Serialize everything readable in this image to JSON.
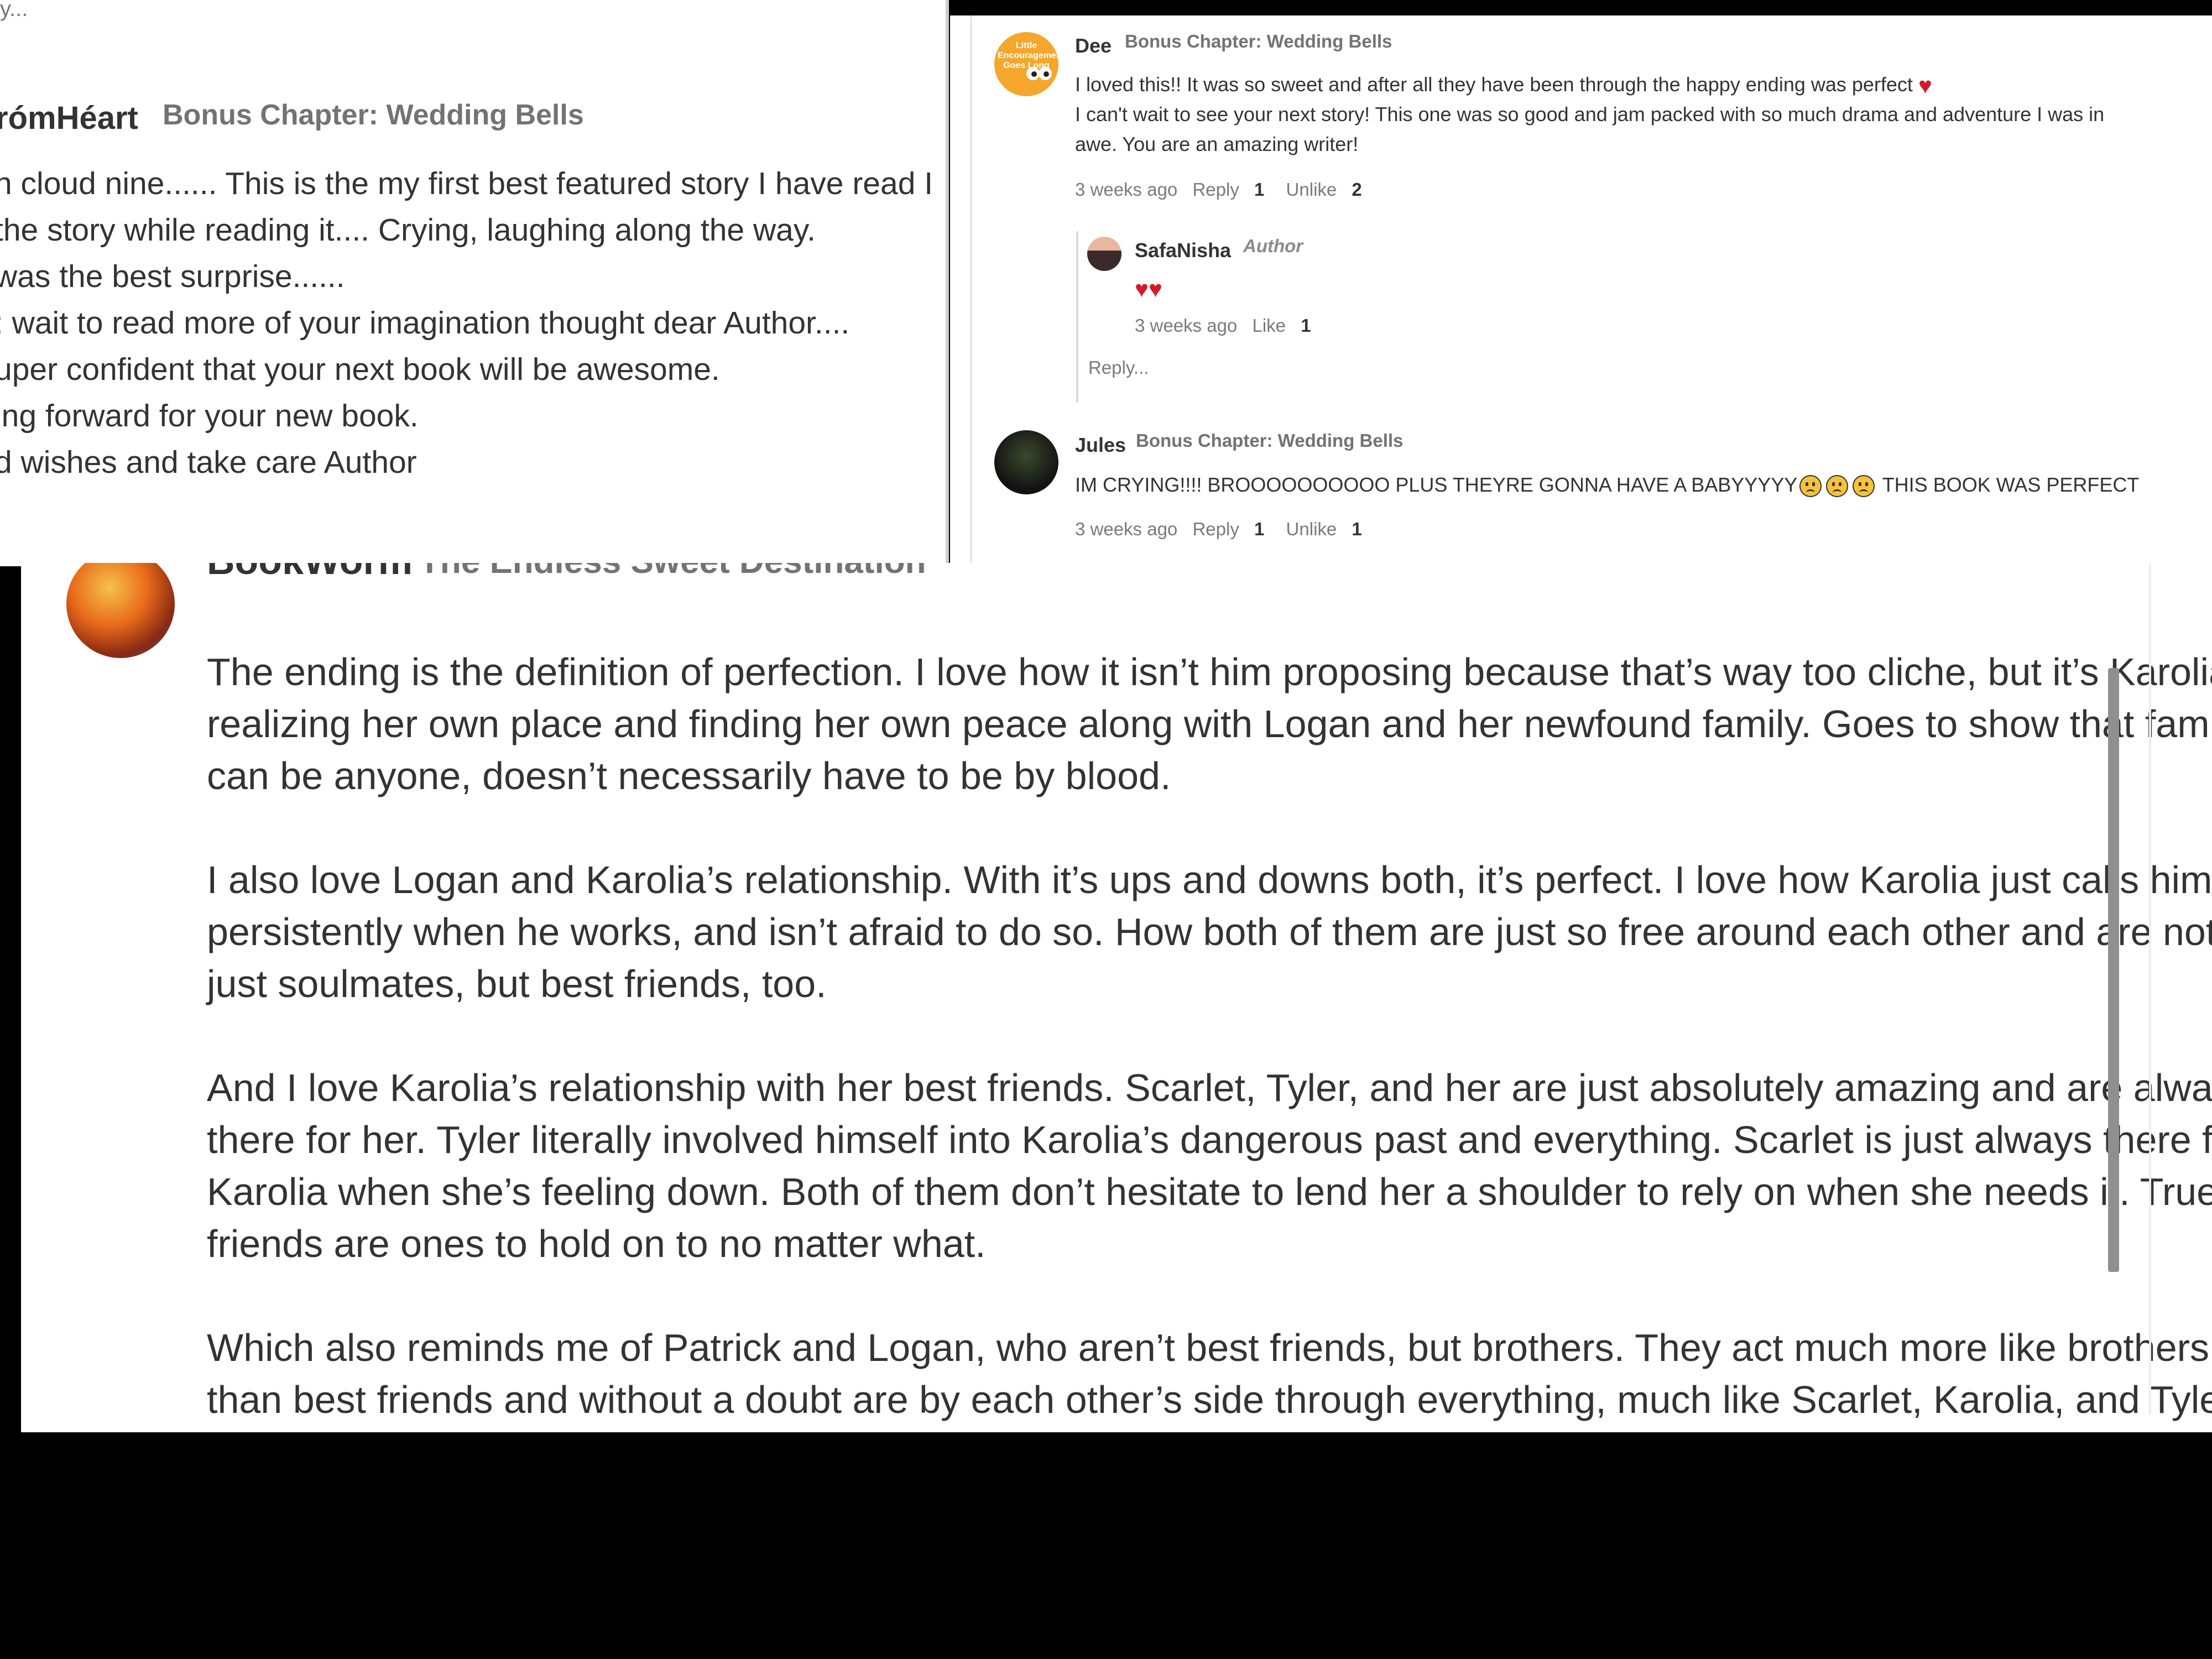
{
  "left_panel": {
    "top_fragment": "y...",
    "author": "rómHéart",
    "chapter": "Bonus Chapter: Wedding Bells",
    "lines": [
      "n cloud nine...... This is the my first best featured story I have read I",
      " the story while reading it.... Crying, laughing along the way.",
      "was the best surprise......",
      ": wait to read more of your imagination thought dear Author....",
      "uper confident that your next book will be awesome.",
      "ing forward for your new book.",
      "d wishes and take care Author"
    ]
  },
  "right_panel": {
    "comments": [
      {
        "author": "Dee",
        "avatar_text": "Little Encouragements Goes Long",
        "chapter": "Bonus Chapter: Wedding Bells",
        "lines": [
          "I loved this!! It was so sweet and after all they have been through the happy ending was perfect",
          "I can't wait to see your next story! This one was so good and jam packed with so much drama and adventure I was in",
          "awe. You are an amazing writer!"
        ],
        "time": "3 weeks ago",
        "reply_label": "Reply",
        "reply_count": "1",
        "like_label": "Unlike",
        "like_count": "2"
      },
      {
        "author": "Jules",
        "chapter": "Bonus Chapter: Wedding Bells",
        "text_before": "IM CRYING!!!! BROOOOOOOOOO PLUS THEYRE GONNA HAVE A BABYYYYY",
        "text_after": " THIS BOOK WAS PERFECT",
        "time": "3 weeks ago",
        "reply_label": "Reply",
        "reply_count": "1",
        "like_label": "Unlike",
        "like_count": "1"
      }
    ],
    "reply": {
      "author": "SafaNisha",
      "badge": "Author",
      "text": "♥♥",
      "time": "3 weeks ago",
      "like_label": "Like",
      "like_count": "1"
    },
    "reply_placeholder": "Reply..."
  },
  "bottom_panel": {
    "author": "BookWorm",
    "chapter": "The Endless Sweet Destination",
    "paragraphs": [
      [
        "The ending is the definition of perfection. I love how it isn’t him proposing because that’s way too cliche, but it’s Karolia",
        "realizing her own place and finding her own peace along with Logan and her newfound family. Goes to show that family",
        "can be anyone, doesn’t necessarily have to be by blood."
      ],
      [
        "I also love Logan and Karolia’s relationship. With it’s ups and downs both, it’s perfect. I love how Karolia just calls him",
        "persistently when he works, and isn’t afraid to do so. How both of them are just so free around each other and are not",
        "just soulmates, but best friends, too."
      ],
      [
        "And I love Karolia’s relationship with her best friends. Scarlet, Tyler, and her are just absolutely amazing and are always",
        "there for her. Tyler literally involved himself into Karolia’s dangerous past and everything. Scarlet is just always there for",
        "Karolia when she’s feeling down. Both of them don’t hesitate to lend her a shoulder to rely on when she needs it. True",
        "friends are ones to hold on to no matter what."
      ],
      [
        "Which also reminds me of Patrick and Logan, who aren’t best friends, but brothers. They act much more like brothers",
        "than best friends and without a doubt are by each other’s side through everything, much like Scarlet, Karolia, and Tyler."
      ]
    ]
  },
  "colors": {
    "heart": "#d51a2a",
    "emoji": "#f5c23a",
    "muted_text": "#737373",
    "body_text": "#333333",
    "backdrop": "#000000"
  }
}
